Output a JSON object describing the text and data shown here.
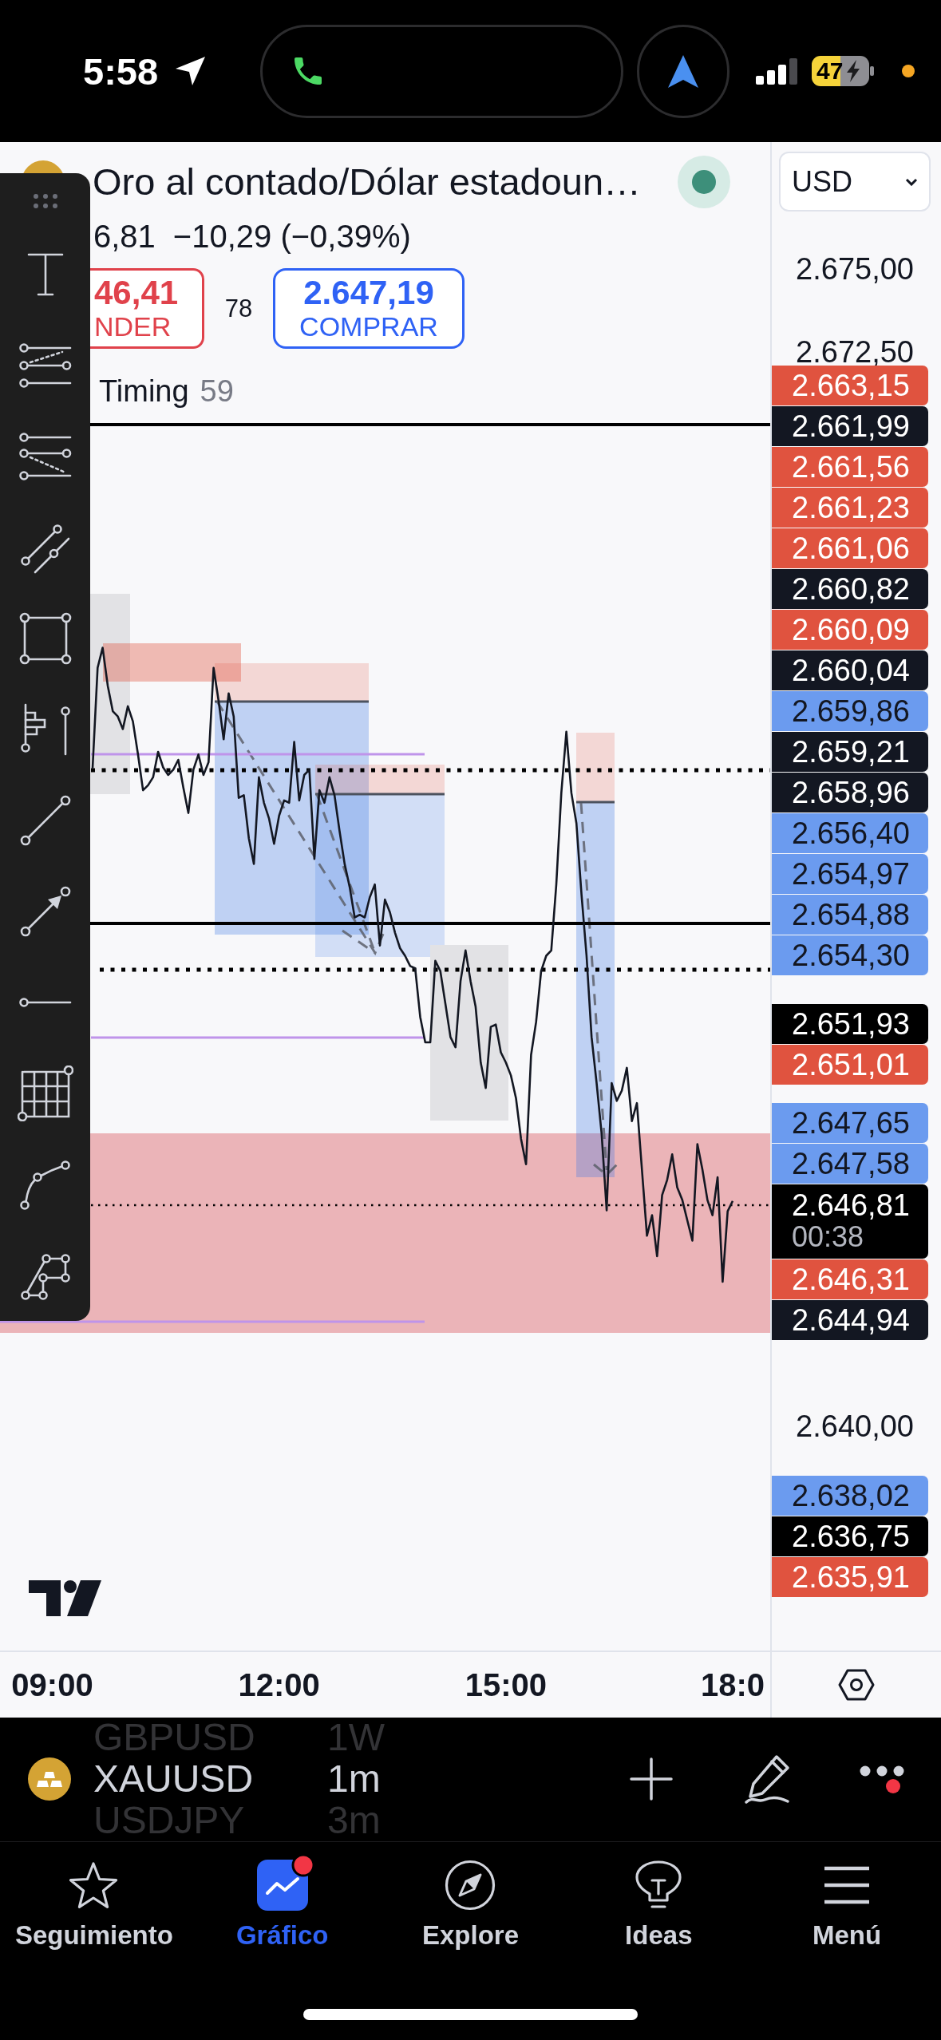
{
  "status_bar": {
    "time": "5:58",
    "battery": "47"
  },
  "symbol": {
    "title": "Oro al contado/Dólar estadoun…",
    "price": "6,81",
    "change": "−10,29 (−0,39%)",
    "market_open": true
  },
  "trade": {
    "sell": {
      "price": "46,41",
      "label": "NDER"
    },
    "spread": "78",
    "buy": {
      "price": "2.647,19",
      "label": "COMPRAR"
    }
  },
  "indicator": {
    "name": "Timing",
    "value": "59"
  },
  "currency": "USD",
  "chart_data": {
    "type": "line",
    "categories": [
      "09:00",
      null,
      null,
      null,
      null,
      null,
      null,
      null,
      null,
      null,
      null,
      null,
      null,
      null,
      null,
      null,
      null,
      null,
      null,
      null,
      null,
      null,
      null,
      null,
      null,
      null,
      null,
      null,
      null,
      null,
      null,
      null,
      null,
      null,
      null,
      null,
      null,
      null,
      null,
      null,
      null,
      null,
      null,
      null,
      null,
      "12:00",
      null,
      null,
      null,
      null,
      null,
      null,
      null,
      null,
      null,
      null,
      null,
      null,
      null,
      null,
      null,
      null,
      null,
      null,
      null,
      null,
      null,
      null,
      null,
      null,
      null,
      null,
      null,
      null,
      null,
      null,
      null,
      null,
      null,
      null,
      null,
      null,
      null,
      null,
      null,
      null,
      null,
      null,
      null,
      null,
      "15:00",
      null,
      null,
      null,
      null,
      null,
      null,
      null,
      null,
      null,
      null,
      null,
      null,
      null,
      null,
      null,
      null,
      null,
      null,
      null,
      null,
      null,
      null,
      null,
      null,
      null,
      null,
      null,
      null,
      null,
      null,
      null,
      null,
      null,
      null,
      null,
      null,
      null,
      null,
      null,
      null,
      null,
      null,
      null,
      null,
      "18:0"
    ],
    "values": [
      null,
      null,
      null,
      null,
      null,
      null,
      null,
      null,
      2659.9,
      2662.94,
      2663.55,
      2662.4,
      2661.63,
      2661.47,
      2661.09,
      2661.78,
      2661.32,
      2660.32,
      2659.24,
      2659.39,
      2659.63,
      2660.4,
      2659.93,
      2659.7,
      2659.86,
      2660.16,
      2659.32,
      2658.55,
      2659.86,
      2660.32,
      2659.7,
      2660.09,
      2662.94,
      2661.94,
      2660.78,
      2662.17,
      2661.47,
      2659.01,
      2659.09,
      2657.78,
      2657.01,
      2659.63,
      2658.86,
      2658.39,
      2657.62,
      2658.47,
      2658.93,
      2658.86,
      2660.7,
      2658.93,
      2659.7,
      2659.86,
      2657.16,
      2659.24,
      2658.86,
      2659.63,
      2659.09,
      2658.01,
      2657.01,
      2656.31,
      2655.39,
      2655.47,
      2655.39,
      2656,
      2656.39,
      2654.54,
      2655.93,
      2655.54,
      2654.93,
      2654.46,
      2654.23,
      2653.92,
      2653.85,
      2652.38,
      2651.61,
      2651.61,
      2654.08,
      2653.77,
      2652.77,
      2651.77,
      2651.46,
      2653.46,
      2654.39,
      2653.46,
      2652.69,
      2651,
      2650.23,
      2652.08,
      2652.15,
      2651.31,
      2651,
      2650.61,
      2649.92,
      2648.69,
      2647.92,
      2651.23,
      2652.23,
      2653.77,
      2654.23,
      2654.39,
      2656.39,
      2659.16,
      2661.01,
      2659.16,
      2658.24,
      2656.08,
      2654.23,
      2651.77,
      2650.38,
      2648.84,
      2646.53,
      2650.38,
      2649.84,
      2650.15,
      2650.84,
      2649.23,
      2649.77,
      2647.76,
      2645.76,
      2646.38,
      2645.14,
      2646.99,
      2647.45,
      2648.22,
      2647.22,
      2646.84,
      2646.22,
      2645.61,
      2648.53,
      2647.76,
      2646.84,
      2646.38,
      2647.53,
      2644.37,
      2646.5,
      2646.81
    ],
    "ylim": [
      2633.21,
      2678.85
    ],
    "yticks": [
      {
        "value": 2675,
        "label": "2.675,00"
      },
      {
        "value": 2672.5,
        "label": "2.672,50"
      },
      {
        "value": 2640,
        "label": "2.640,00"
      }
    ]
  },
  "price_labels": [
    {
      "price": "2.663,15",
      "color": "#e0533f"
    },
    {
      "price": "2.661,99",
      "color": "#131722"
    },
    {
      "price": "2.661,56",
      "color": "#e0533f"
    },
    {
      "price": "2.661,23",
      "color": "#e0533f"
    },
    {
      "price": "2.661,06",
      "color": "#e0533f"
    },
    {
      "price": "2.660,82",
      "color": "#131722"
    },
    {
      "price": "2.660,09",
      "color": "#e0533f"
    },
    {
      "price": "2.660,04",
      "color": "#131722"
    },
    {
      "price": "2.659,86",
      "color": "#6b9bef"
    },
    {
      "price": "2.659,21",
      "color": "#131722"
    },
    {
      "price": "2.658,96",
      "color": "#131722"
    },
    {
      "price": "2.656,40",
      "color": "#6b9bef"
    },
    {
      "price": "2.654,97",
      "color": "#6b9bef"
    },
    {
      "price": "2.654,88",
      "color": "#6b9bef"
    },
    {
      "price": "2.654,30",
      "color": "#6b9bef"
    },
    {
      "price": "2.651,93",
      "color": "#000000"
    },
    {
      "price": "2.651,01",
      "color": "#e0533f"
    },
    {
      "price": "2.647,65",
      "color": "#6b9bef"
    },
    {
      "price": "2.647,58",
      "color": "#6b9bef"
    },
    {
      "price": "2.646,81",
      "countdown": "00:38",
      "color": "#000000"
    },
    {
      "price": "2.646,31",
      "color": "#e0533f"
    },
    {
      "price": "2.644,94",
      "color": "#131722"
    },
    {
      "price": "2.638,02",
      "color": "#6b9bef"
    },
    {
      "price": "2.636,75",
      "color": "#000000"
    },
    {
      "price": "2.635,91",
      "color": "#e0533f"
    }
  ],
  "symbol_bar": {
    "rows": [
      {
        "symbol": "GBPUSD",
        "interval": "1W",
        "selected": false
      },
      {
        "symbol": "XAUUSD",
        "interval": "1m",
        "selected": true
      },
      {
        "symbol": "USDJPY",
        "interval": "3m",
        "selected": false
      }
    ],
    "more_notification": true
  },
  "tabs": [
    {
      "label": "Seguimiento",
      "selected": false,
      "notification": false
    },
    {
      "label": "Gráfico",
      "selected": true,
      "notification": true
    },
    {
      "label": "Explore",
      "selected": false,
      "notification": false
    },
    {
      "label": "Ideas",
      "selected": false,
      "notification": false
    },
    {
      "label": "Menú",
      "selected": false,
      "notification": false
    }
  ]
}
